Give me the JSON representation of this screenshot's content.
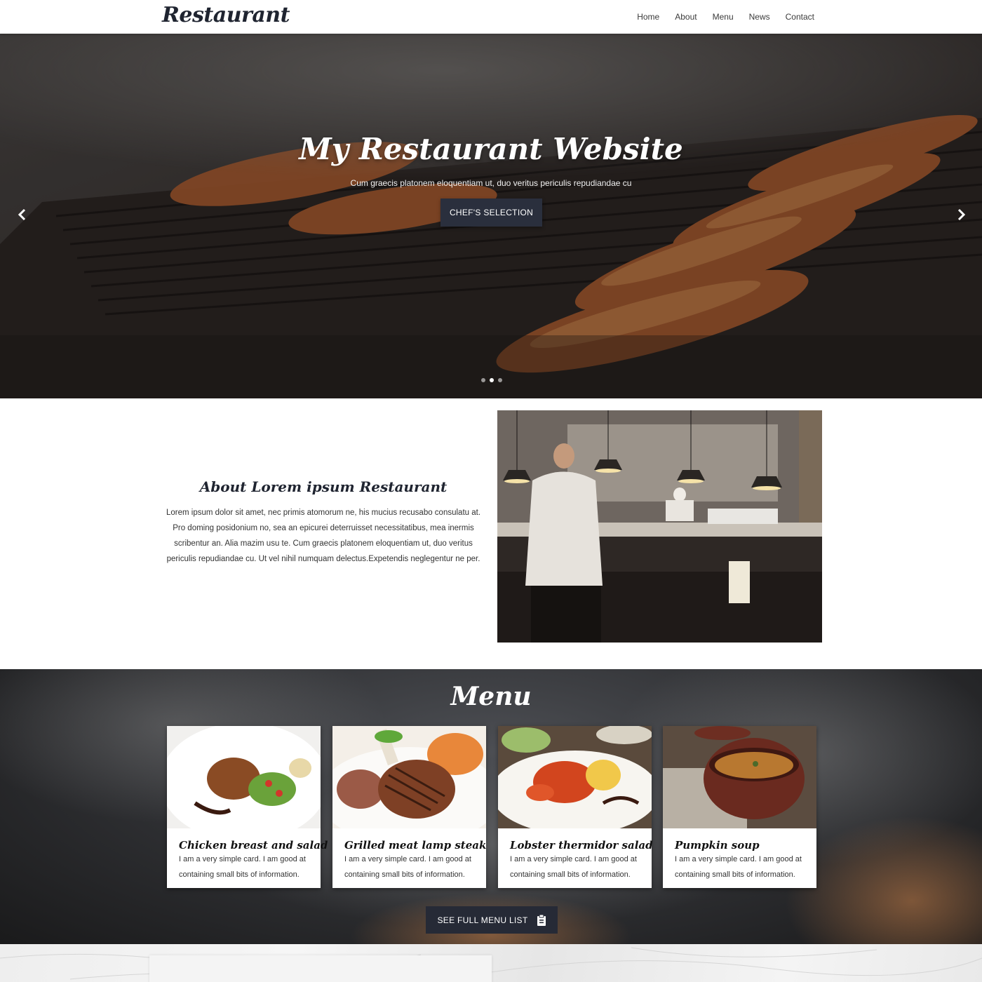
{
  "navbar": {
    "brand": "Restaurant",
    "links": [
      "Home",
      "About",
      "Menu",
      "News",
      "Contact"
    ]
  },
  "hero": {
    "title": "My Restaurant Website",
    "subtitle": "Cum graecis platonem eloquentiam ut, duo veritus periculis repudiandae cu",
    "button": "CHEF'S SELECTION",
    "prev_icon": "chevron-left-icon",
    "next_icon": "chevron-right-icon",
    "slide_count": 3,
    "active_slide": 2
  },
  "about": {
    "title": "About Lorem ipsum Restaurant",
    "body": "Lorem ipsum dolor sit amet, nec primis atomorum ne, his mucius recusabo consulatu at. Pro doming posidonium no, sea an epicurei deterruisset necessitatibus, mea inermis scribentur an. Alia mazim usu te. Cum graecis platonem eloquentiam ut, duo veritus periculis repudiandae cu. Ut vel nihil numquam delectus.Expetendis neglegentur ne per."
  },
  "menu": {
    "title": "Menu",
    "items": [
      {
        "title": "Chicken breast and salad",
        "text": "I am a very simple card. I am good at containing small bits of information."
      },
      {
        "title": "Grilled meat lamp steak",
        "text": "I am a very simple card. I am good at containing small bits of information."
      },
      {
        "title": "Lobster thermidor salad",
        "text": "I am a very simple card. I am good at containing small bits of information."
      },
      {
        "title": "Pumpkin soup",
        "text": "I am a very simple card. I am good at containing small bits of information."
      }
    ],
    "button": "SEE FULL MENU LIST",
    "button_icon": "clipboard-icon"
  },
  "colors": {
    "brand_dark": "#1f2430",
    "button_dark": "#2a2f3d"
  }
}
